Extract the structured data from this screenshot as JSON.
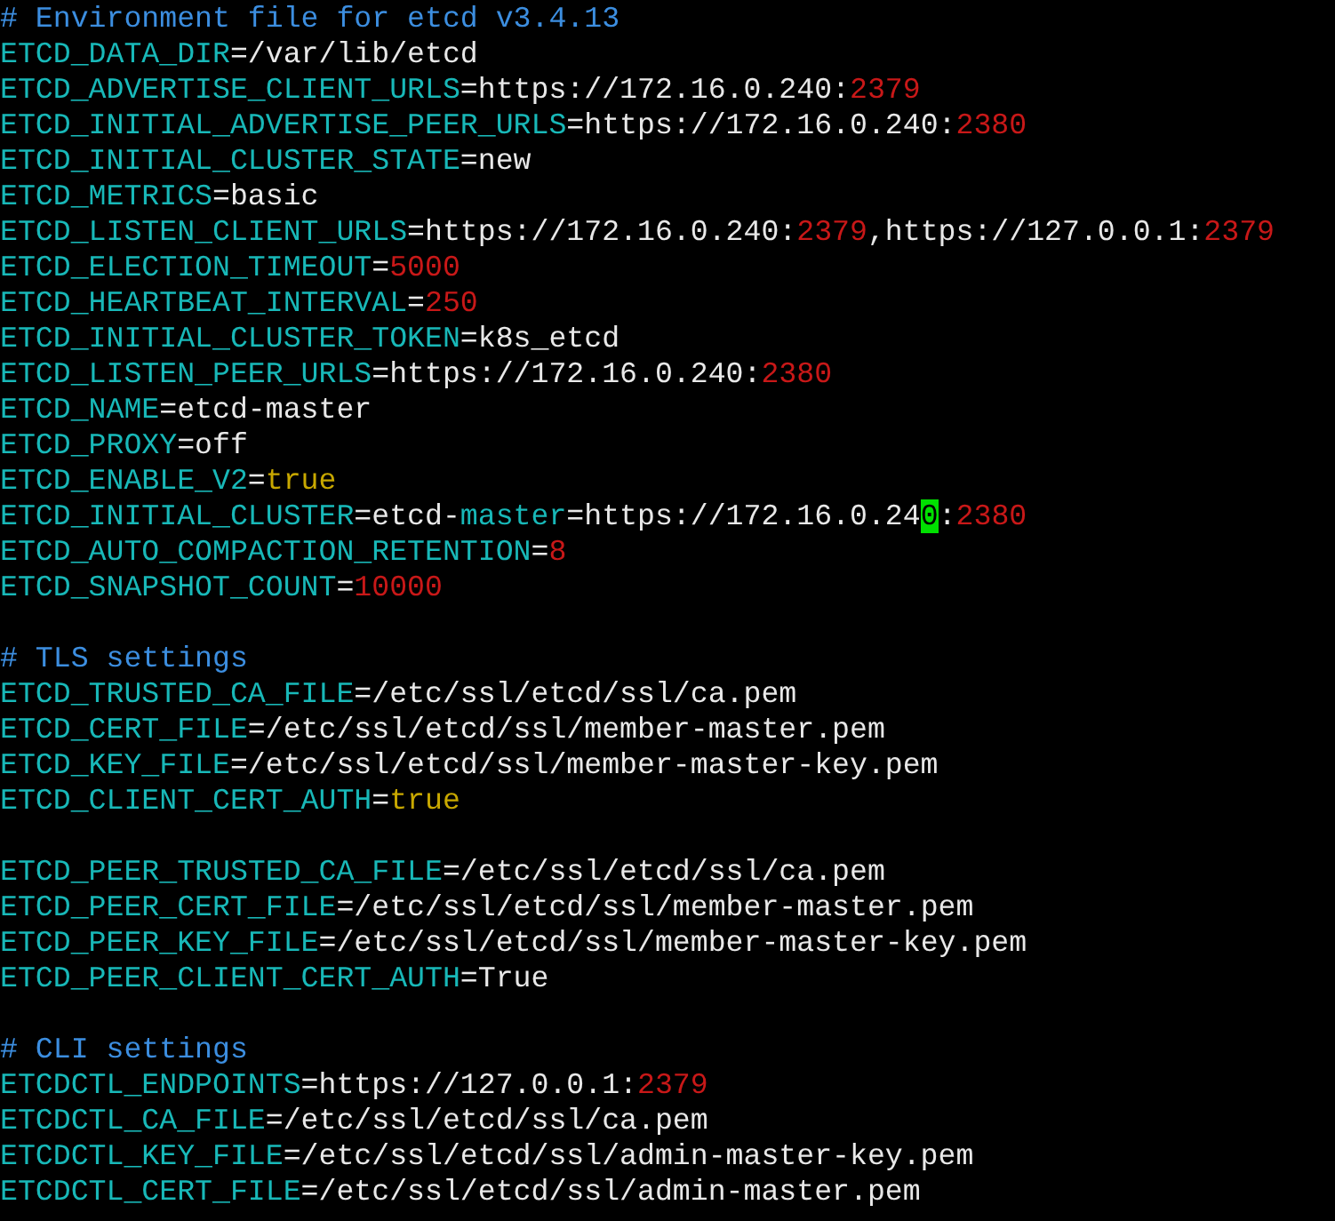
{
  "lines": [
    {
      "kind": "code",
      "segments": [
        {
          "kind": "comment",
          "text": "# Environment file for etcd v3.4.13"
        }
      ]
    },
    {
      "kind": "code",
      "segments": [
        {
          "kind": "key",
          "text": "ETCD_DATA_DIR"
        },
        {
          "kind": "text",
          "text": "=/var/lib/etcd"
        }
      ]
    },
    {
      "kind": "code",
      "segments": [
        {
          "kind": "key",
          "text": "ETCD_ADVERTISE_CLIENT_URLS"
        },
        {
          "kind": "text",
          "text": "=https://172.16.0.240:"
        },
        {
          "kind": "number",
          "text": "2379"
        }
      ]
    },
    {
      "kind": "code",
      "segments": [
        {
          "kind": "key",
          "text": "ETCD_INITIAL_ADVERTISE_PEER_URLS"
        },
        {
          "kind": "text",
          "text": "=https://172.16.0.240:"
        },
        {
          "kind": "number",
          "text": "2380"
        }
      ]
    },
    {
      "kind": "code",
      "segments": [
        {
          "kind": "key",
          "text": "ETCD_INITIAL_CLUSTER_STATE"
        },
        {
          "kind": "text",
          "text": "=new"
        }
      ]
    },
    {
      "kind": "code",
      "segments": [
        {
          "kind": "key",
          "text": "ETCD_METRICS"
        },
        {
          "kind": "text",
          "text": "=basic"
        }
      ]
    },
    {
      "kind": "code",
      "segments": [
        {
          "kind": "key",
          "text": "ETCD_LISTEN_CLIENT_URLS"
        },
        {
          "kind": "text",
          "text": "=https://172.16.0.240:"
        },
        {
          "kind": "number",
          "text": "2379"
        },
        {
          "kind": "text",
          "text": ",https://127.0.0.1:"
        },
        {
          "kind": "number",
          "text": "2379"
        }
      ]
    },
    {
      "kind": "code",
      "segments": [
        {
          "kind": "key",
          "text": "ETCD_ELECTION_TIMEOUT"
        },
        {
          "kind": "text",
          "text": "="
        },
        {
          "kind": "number",
          "text": "5000"
        }
      ]
    },
    {
      "kind": "code",
      "segments": [
        {
          "kind": "key",
          "text": "ETCD_HEARTBEAT_INTERVAL"
        },
        {
          "kind": "text",
          "text": "="
        },
        {
          "kind": "number",
          "text": "250"
        }
      ]
    },
    {
      "kind": "code",
      "segments": [
        {
          "kind": "key",
          "text": "ETCD_INITIAL_CLUSTER_TOKEN"
        },
        {
          "kind": "text",
          "text": "=k8s_etcd"
        }
      ]
    },
    {
      "kind": "code",
      "segments": [
        {
          "kind": "key",
          "text": "ETCD_LISTEN_PEER_URLS"
        },
        {
          "kind": "text",
          "text": "=https://172.16.0.240:"
        },
        {
          "kind": "number",
          "text": "2380"
        }
      ]
    },
    {
      "kind": "code",
      "segments": [
        {
          "kind": "key",
          "text": "ETCD_NAME"
        },
        {
          "kind": "text",
          "text": "=etcd-master"
        }
      ]
    },
    {
      "kind": "code",
      "segments": [
        {
          "kind": "key",
          "text": "ETCD_PROXY"
        },
        {
          "kind": "text",
          "text": "=off"
        }
      ]
    },
    {
      "kind": "code",
      "segments": [
        {
          "kind": "key",
          "text": "ETCD_ENABLE_V2"
        },
        {
          "kind": "text",
          "text": "="
        },
        {
          "kind": "bool",
          "text": "true"
        }
      ]
    },
    {
      "kind": "code",
      "segments": [
        {
          "kind": "key",
          "text": "ETCD_INITIAL_CLUSTER"
        },
        {
          "kind": "text",
          "text": "=etcd-"
        },
        {
          "kind": "key",
          "text": "master"
        },
        {
          "kind": "text",
          "text": "=https://172.16.0.24"
        },
        {
          "kind": "cursor",
          "text": "0"
        },
        {
          "kind": "text",
          "text": ":"
        },
        {
          "kind": "number",
          "text": "2380"
        }
      ]
    },
    {
      "kind": "code",
      "segments": [
        {
          "kind": "key",
          "text": "ETCD_AUTO_COMPACTION_RETENTION"
        },
        {
          "kind": "text",
          "text": "="
        },
        {
          "kind": "number",
          "text": "8"
        }
      ]
    },
    {
      "kind": "code",
      "segments": [
        {
          "kind": "key",
          "text": "ETCD_SNAPSHOT_COUNT"
        },
        {
          "kind": "text",
          "text": "="
        },
        {
          "kind": "number",
          "text": "10000"
        }
      ]
    },
    {
      "kind": "blank"
    },
    {
      "kind": "code",
      "segments": [
        {
          "kind": "comment",
          "text": "# TLS settings"
        }
      ]
    },
    {
      "kind": "code",
      "segments": [
        {
          "kind": "key",
          "text": "ETCD_TRUSTED_CA_FILE"
        },
        {
          "kind": "text",
          "text": "=/etc/ssl/etcd/ssl/ca.pem"
        }
      ]
    },
    {
      "kind": "code",
      "segments": [
        {
          "kind": "key",
          "text": "ETCD_CERT_FILE"
        },
        {
          "kind": "text",
          "text": "=/etc/ssl/etcd/ssl/member-master.pem"
        }
      ]
    },
    {
      "kind": "code",
      "segments": [
        {
          "kind": "key",
          "text": "ETCD_KEY_FILE"
        },
        {
          "kind": "text",
          "text": "=/etc/ssl/etcd/ssl/member-master-key.pem"
        }
      ]
    },
    {
      "kind": "code",
      "segments": [
        {
          "kind": "key",
          "text": "ETCD_CLIENT_CERT_AUTH"
        },
        {
          "kind": "text",
          "text": "="
        },
        {
          "kind": "bool",
          "text": "true"
        }
      ]
    },
    {
      "kind": "blank"
    },
    {
      "kind": "code",
      "segments": [
        {
          "kind": "key",
          "text": "ETCD_PEER_TRUSTED_CA_FILE"
        },
        {
          "kind": "text",
          "text": "=/etc/ssl/etcd/ssl/ca.pem"
        }
      ]
    },
    {
      "kind": "code",
      "segments": [
        {
          "kind": "key",
          "text": "ETCD_PEER_CERT_FILE"
        },
        {
          "kind": "text",
          "text": "=/etc/ssl/etcd/ssl/member-master.pem"
        }
      ]
    },
    {
      "kind": "code",
      "segments": [
        {
          "kind": "key",
          "text": "ETCD_PEER_KEY_FILE"
        },
        {
          "kind": "text",
          "text": "=/etc/ssl/etcd/ssl/member-master-key.pem"
        }
      ]
    },
    {
      "kind": "code",
      "segments": [
        {
          "kind": "key",
          "text": "ETCD_PEER_CLIENT_CERT_AUTH"
        },
        {
          "kind": "text",
          "text": "=True"
        }
      ]
    },
    {
      "kind": "blank"
    },
    {
      "kind": "code",
      "segments": [
        {
          "kind": "comment",
          "text": "# CLI settings"
        }
      ]
    },
    {
      "kind": "code",
      "segments": [
        {
          "kind": "key",
          "text": "ETCDCTL_ENDPOINTS"
        },
        {
          "kind": "text",
          "text": "=https://127.0.0.1:"
        },
        {
          "kind": "number",
          "text": "2379"
        }
      ]
    },
    {
      "kind": "code",
      "segments": [
        {
          "kind": "key",
          "text": "ETCDCTL_CA_FILE"
        },
        {
          "kind": "text",
          "text": "=/etc/ssl/etcd/ssl/ca.pem"
        }
      ]
    },
    {
      "kind": "code",
      "segments": [
        {
          "kind": "key",
          "text": "ETCDCTL_KEY_FILE"
        },
        {
          "kind": "text",
          "text": "=/etc/ssl/etcd/ssl/admin-master-key.pem"
        }
      ]
    },
    {
      "kind": "code",
      "segments": [
        {
          "kind": "key",
          "text": "ETCDCTL_CERT_FILE"
        },
        {
          "kind": "text",
          "text": "=/etc/ssl/etcd/ssl/admin-master.pem"
        }
      ]
    }
  ]
}
